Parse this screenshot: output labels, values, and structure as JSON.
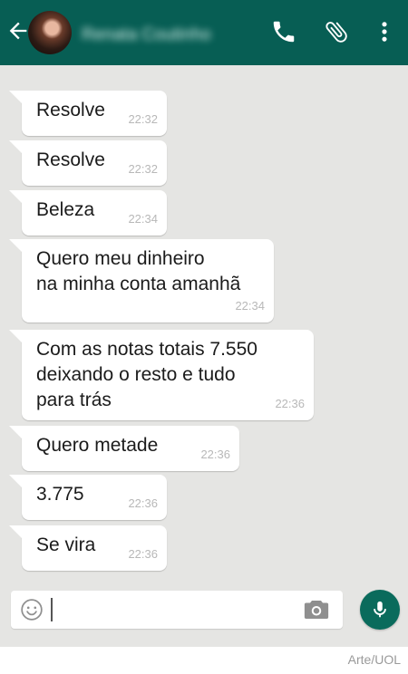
{
  "header": {
    "contact_name": "Renata Coutinho",
    "color": "#075e54"
  },
  "messages": [
    {
      "text": "Resolve",
      "time": "22:32"
    },
    {
      "text": "Resolve",
      "time": "22:32"
    },
    {
      "text": "Beleza",
      "time": "22:34"
    },
    {
      "text": "Quero meu dinheiro\nna minha conta amanhã",
      "time": "22:34"
    },
    {
      "text": "Com as notas totais 7.550\ndeixando o resto e tudo\npara trás",
      "time": "22:36"
    },
    {
      "text": "Quero metade",
      "time": "22:36"
    },
    {
      "text": "3.775",
      "time": "22:36"
    },
    {
      "text": "Se vira",
      "time": "22:36"
    }
  ],
  "icons": {
    "back": "back-arrow-icon",
    "call": "phone-icon",
    "attach": "paperclip-icon",
    "menu": "more-vert-icon",
    "emoji": "emoji-icon",
    "camera": "camera-icon",
    "mic": "mic-icon"
  },
  "input": {
    "value": ""
  },
  "footer": {
    "credit": "Arte/UOL"
  }
}
